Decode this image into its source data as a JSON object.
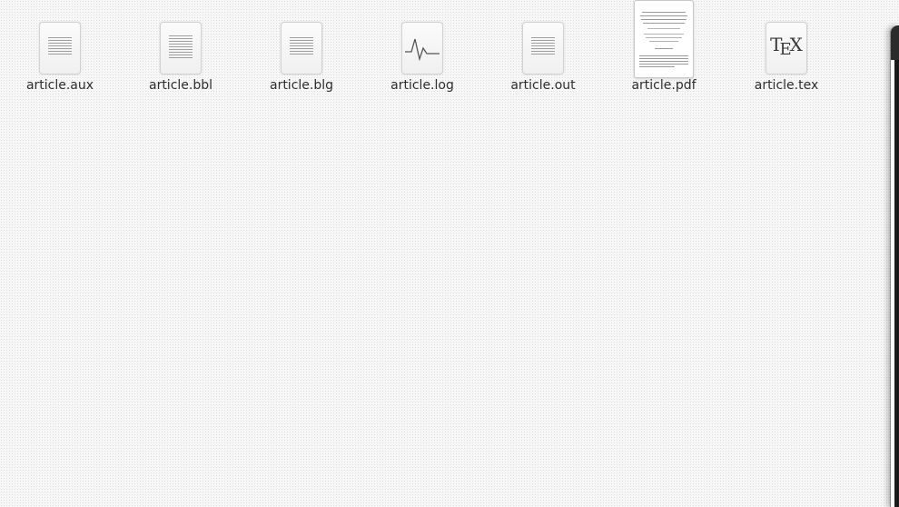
{
  "desktop": {
    "files": [
      {
        "name": "article.aux",
        "icon": "text-document-icon"
      },
      {
        "name": "article.bbl",
        "icon": "text-document-icon"
      },
      {
        "name": "article.blg",
        "icon": "text-document-icon"
      },
      {
        "name": "article.log",
        "icon": "log-file-icon"
      },
      {
        "name": "article.out",
        "icon": "text-document-icon"
      },
      {
        "name": "article.pdf",
        "icon": "pdf-thumbnail-icon"
      },
      {
        "name": "article.tex",
        "icon": "tex-file-icon",
        "glyph_t": "T",
        "glyph_e": "E",
        "glyph_x": "X"
      }
    ]
  },
  "colors": {
    "background": "#f7f7f7",
    "label_text": "#2e2e2e",
    "window_titlebar": "#2b2b2b"
  }
}
